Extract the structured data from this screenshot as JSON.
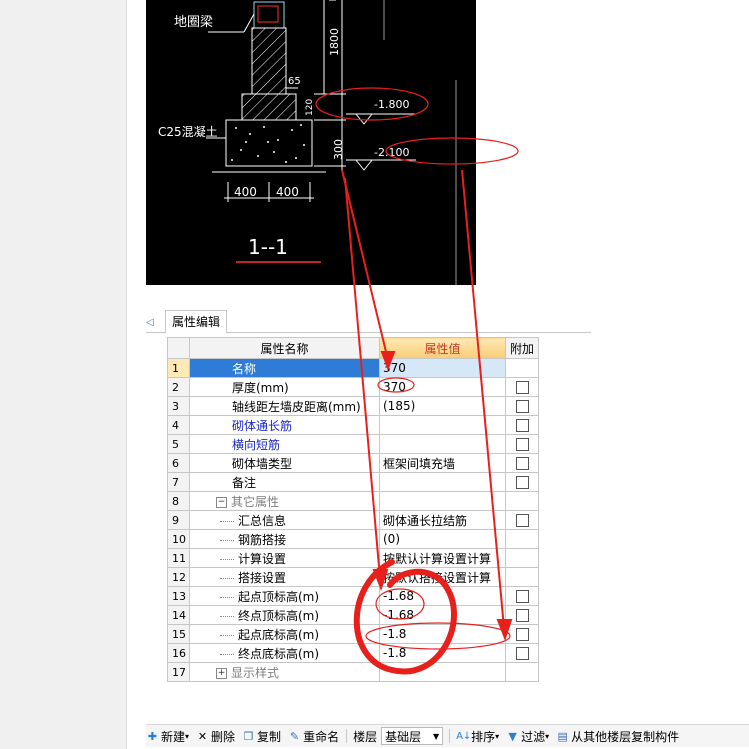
{
  "cad": {
    "beam_label": "地圈梁",
    "dim_1800": "1800",
    "dim_65": "65",
    "dim_120": "120",
    "dim_300": "300",
    "elev_top": "-1.800",
    "elev_bottom": "-2.100",
    "concrete_label": "C25混凝土",
    "dim_400a": "400",
    "dim_400b": "400",
    "section_label": "1--1"
  },
  "panel": {
    "tab_label": "属性编辑",
    "headers": {
      "name": "属性名称",
      "value": "属性值",
      "extra": "附加"
    }
  },
  "rows": [
    {
      "num": "1",
      "name": "名称",
      "value": "370",
      "checkbox": false
    },
    {
      "num": "2",
      "name": "厚度(mm)",
      "value": "370",
      "checkbox": true
    },
    {
      "num": "3",
      "name": "轴线距左墙皮距离(mm)",
      "value": "(185)",
      "checkbox": true
    },
    {
      "num": "4",
      "name": "砌体通长筋",
      "value": "",
      "checkbox": true
    },
    {
      "num": "5",
      "name": "横向短筋",
      "value": "",
      "checkbox": true
    },
    {
      "num": "6",
      "name": "砌体墙类型",
      "value": "框架间填充墙",
      "checkbox": true
    },
    {
      "num": "7",
      "name": "备注",
      "value": "",
      "checkbox": true
    },
    {
      "num": "8",
      "name": "其它属性",
      "value": "",
      "checkbox": false,
      "tree": "−"
    },
    {
      "num": "9",
      "name": "汇总信息",
      "value": "砌体通长拉结筋",
      "checkbox": true
    },
    {
      "num": "10",
      "name": "钢筋搭接",
      "value": "(0)",
      "checkbox": false
    },
    {
      "num": "11",
      "name": "计算设置",
      "value": "按默认计算设置计算",
      "checkbox": false
    },
    {
      "num": "12",
      "name": "搭接设置",
      "value": "按默认搭接设置计算",
      "checkbox": false
    },
    {
      "num": "13",
      "name": "起点顶标高(m)",
      "value": "-1.68",
      "checkbox": true
    },
    {
      "num": "14",
      "name": "终点顶标高(m)",
      "value": "-1.68",
      "checkbox": true
    },
    {
      "num": "15",
      "name": "起点底标高(m)",
      "value": "-1.8",
      "checkbox": true
    },
    {
      "num": "16",
      "name": "终点底标高(m)",
      "value": "-1.8",
      "checkbox": true
    },
    {
      "num": "17",
      "name": "显示样式",
      "value": "",
      "checkbox": false,
      "tree": "+"
    }
  ],
  "toolbar": {
    "new": "新建",
    "delete": "删除",
    "copy": "复制",
    "rename": "重命名",
    "floor_label": "楼层",
    "floor_value": "基础层",
    "sort": "排序",
    "filter": "过滤",
    "copy_from": "从其他楼层复制构件"
  },
  "colors": {
    "annotation_red": "#e8201c",
    "selection_blue": "#2e7cd6",
    "header_orange": "#f8cc78",
    "link_blue": "#1a25c8"
  }
}
